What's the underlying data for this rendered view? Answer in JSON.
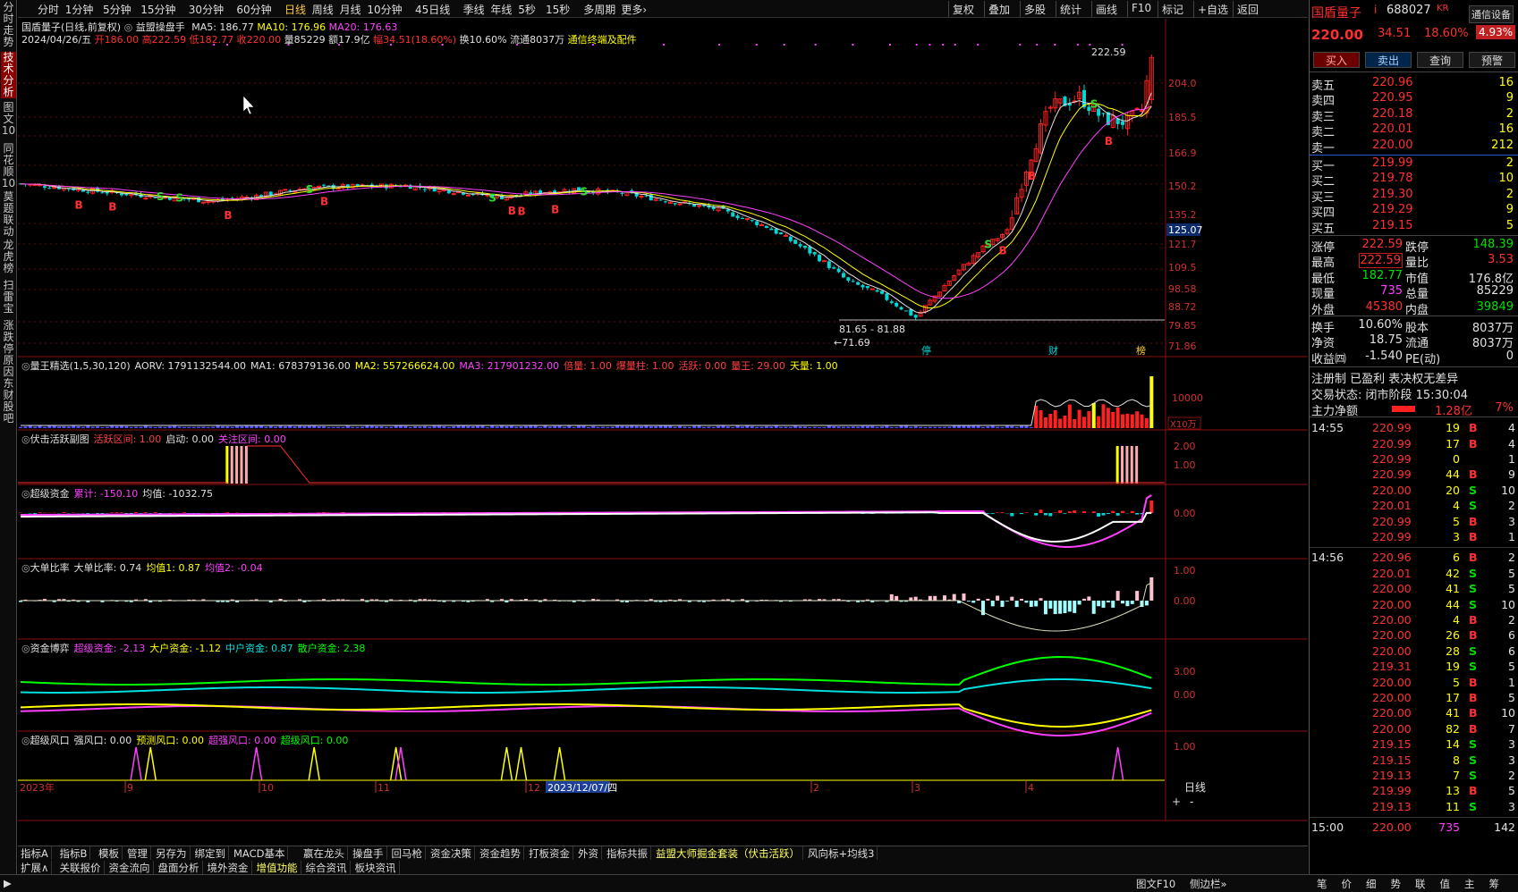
{
  "left_tabs": [
    "分时走势",
    "技术分析",
    "图文10",
    "同花顺10",
    "莫题联动",
    "龙虎榜",
    "扫雷宝",
    "涨跌停原因",
    "东财股吧"
  ],
  "periods": [
    "分时",
    "1分钟",
    "5分钟",
    "15分钟",
    "30分钟",
    "60分钟",
    "日线",
    "周线",
    "月线",
    "10分钟",
    "45日线",
    "季线",
    "年线",
    "5秒",
    "15秒",
    "多周期",
    "更多›"
  ],
  "selected_period": "日线",
  "top_right": [
    "复权",
    "叠加",
    "多股",
    "统计",
    "画线",
    "F10",
    "标记",
    "+自选",
    "返回"
  ],
  "main_title": "国盾量子(日线,前复权)",
  "indicator_name": "益盟操盘手",
  "ma": {
    "ma5": "MA5: 186.77",
    "ma10": "MA10: 176.96",
    "ma20": "MA20: 176.63"
  },
  "ohlc_line": {
    "date": "2024/04/26/五",
    "open": "开186.00",
    "high": "高222.59",
    "low": "低182.77",
    "close": "收220.00",
    "vol": "量85229",
    "amt": "额17.9亿",
    "change": "幅34.51(18.60%)",
    "turnover": "换10.60%",
    "float": "流通8037万",
    "note": "通信终端及配件"
  },
  "price_axis": [
    "204.0",
    "185.5",
    "166.9",
    "150.2",
    "135.2",
    "121.7",
    "109.5",
    "98.58",
    "88.72",
    "79.85",
    "71.86"
  ],
  "current_price_tag": "125.07",
  "annotations": {
    "high": "222.59",
    "low": "71.69",
    "range": "81.65 - 81.88"
  },
  "event_marks": [
    "停",
    "财",
    "榜"
  ],
  "panes": [
    {
      "id": "volume",
      "title": "量王精选(1,5,30,120)",
      "items": [
        {
          "t": "AORV: 1791132544.00",
          "c": "#e0e0e0"
        },
        {
          "t": "MA1: 678379136.00",
          "c": "#e0e0e0"
        },
        {
          "t": "MA2: 557266624.00",
          "c": "#ffff00"
        },
        {
          "t": "MA3: 217901232.00",
          "c": "#ff40ff"
        },
        {
          "t": "倍量: 1.00",
          "c": "#ff4040"
        },
        {
          "t": "爆量柱: 1.00",
          "c": "#ff4040"
        },
        {
          "t": "活跃: 0.00",
          "c": "#ff4040"
        },
        {
          "t": "量王: 29.00",
          "c": "#ff4040"
        },
        {
          "t": "天量: 1.00",
          "c": "#ffff00"
        }
      ],
      "axis": [
        "10000",
        "X10万"
      ]
    },
    {
      "id": "active",
      "title": "伏击活跃副图",
      "items": [
        {
          "t": "活跃区间: 1.00",
          "c": "#ff4040"
        },
        {
          "t": "启动: 0.00",
          "c": "#e0e0e0"
        },
        {
          "t": "关注区间: 0.00",
          "c": "#ff40ff"
        }
      ],
      "axis": [
        "2.00",
        "1.00"
      ]
    },
    {
      "id": "superfund",
      "title": "超级资金",
      "items": [
        {
          "t": "累计: -150.10",
          "c": "#ff40ff"
        },
        {
          "t": "均值: -1032.75",
          "c": "#e0e0e0"
        }
      ],
      "axis": [
        "0.00"
      ]
    },
    {
      "id": "bigratio",
      "title": "大单比率",
      "items": [
        {
          "t": "大单比率: 0.74",
          "c": "#e0e0e0"
        },
        {
          "t": "均值1: 0.87",
          "c": "#ffff00"
        },
        {
          "t": "均值2: -0.04",
          "c": "#ff40ff"
        }
      ],
      "axis": [
        "1.00",
        "0.00"
      ]
    },
    {
      "id": "game",
      "title": "资金博弈",
      "items": [
        {
          "t": "超级资金: -2.13",
          "c": "#ff40ff"
        },
        {
          "t": "大户资金: -1.12",
          "c": "#ffff00"
        },
        {
          "t": "中户资金: 0.87",
          "c": "#00e0e0"
        },
        {
          "t": "散户资金: 2.38",
          "c": "#00ff00"
        }
      ],
      "axis": [
        "3.00",
        "0.00"
      ]
    },
    {
      "id": "wind",
      "title": "超级风口",
      "items": [
        {
          "t": "强风口: 0.00",
          "c": "#e0e0e0"
        },
        {
          "t": "预测风口: 0.00",
          "c": "#ffff00"
        },
        {
          "t": "超强风口: 0.00",
          "c": "#ff40ff"
        },
        {
          "t": "超级风口: 0.00",
          "c": "#00ff00"
        }
      ],
      "axis": [
        "1.00"
      ]
    }
  ],
  "date_axis": [
    "2023年",
    "9",
    "10",
    "11",
    "12",
    "2023/12/07/四",
    "2",
    "3",
    "4"
  ],
  "date_right": "日线",
  "bottom_tabs1": [
    "指标A",
    "指标B",
    "模板",
    "管理",
    "另存为",
    "绑定到",
    "MACD基本",
    "嬴在龙头",
    "操盘手",
    "回马枪",
    "资金决策",
    "资金趋势",
    "打板资金",
    "外资",
    "指标共振",
    "益盟大师掘金套装（伏击活跃）",
    "风向标+均线3"
  ],
  "bottom_tabs2": [
    "扩展∧",
    "关联报价",
    "资金流向",
    "盘面分析",
    "境外资金",
    "增值功能",
    "综合资讯",
    "板块资讯"
  ],
  "stock": {
    "name": "国盾量子",
    "mark": "i",
    "code": "688027",
    "tag": "KR",
    "price": "220.00",
    "change": "34.51",
    "pct": "18.60%",
    "amp": "4.93%",
    "btn_comm": "通信设备"
  },
  "trade_buttons": [
    "买入",
    "卖出",
    "查询",
    "预警"
  ],
  "order_book": {
    "sells": [
      {
        "l": "卖五",
        "p": "220.96",
        "v": "16"
      },
      {
        "l": "卖四",
        "p": "220.95",
        "v": "9"
      },
      {
        "l": "卖三",
        "p": "220.18",
        "v": "2"
      },
      {
        "l": "卖二",
        "p": "220.01",
        "v": "16"
      },
      {
        "l": "卖一",
        "p": "220.00",
        "v": "212"
      }
    ],
    "buys": [
      {
        "l": "买一",
        "p": "219.99",
        "v": "2"
      },
      {
        "l": "买二",
        "p": "219.78",
        "v": "10"
      },
      {
        "l": "买三",
        "p": "219.30",
        "v": "2"
      },
      {
        "l": "买四",
        "p": "219.29",
        "v": "9"
      },
      {
        "l": "买五",
        "p": "219.15",
        "v": "5"
      }
    ]
  },
  "stats": [
    [
      "涨停",
      "222.59",
      "跌停",
      "148.39"
    ],
    [
      "最高",
      "222.59",
      "量比",
      "3.53"
    ],
    [
      "最低",
      "182.77",
      "市值",
      "176.8亿"
    ],
    [
      "现量",
      "735",
      "总量",
      "85229"
    ],
    [
      "外盘",
      "45380",
      "内盘",
      "39849"
    ],
    [
      "换手",
      "10.60%",
      "股本",
      "8037万"
    ],
    [
      "净资",
      "18.75",
      "流通",
      "8037万"
    ],
    [
      "收益㈣",
      "-1.540",
      "PE(动)",
      "0"
    ]
  ],
  "reg": "注册制 已盈利 表决权无差异",
  "trade_status": "交易状态: 闭市阶段 15:30:04",
  "main_net": {
    "label": "主力净额",
    "value": "1.28亿",
    "pct": "7%"
  },
  "ticks": [
    {
      "t": "14:55",
      "p": "220.99",
      "v": "19",
      "s": "B",
      "n": "4"
    },
    {
      "t": "",
      "p": "220.99",
      "v": "17",
      "s": "B",
      "n": "4"
    },
    {
      "t": "",
      "p": "220.99",
      "v": "0",
      "s": "",
      "n": "1"
    },
    {
      "t": "",
      "p": "220.99",
      "v": "44",
      "s": "B",
      "n": "9"
    },
    {
      "t": "",
      "p": "220.00",
      "v": "20",
      "s": "S",
      "n": "10"
    },
    {
      "t": "",
      "p": "220.01",
      "v": "4",
      "s": "S",
      "n": "2"
    },
    {
      "t": "",
      "p": "220.99",
      "v": "5",
      "s": "B",
      "n": "3"
    },
    {
      "t": "",
      "p": "220.99",
      "v": "3",
      "s": "B",
      "n": "1"
    },
    {
      "t": "14:56",
      "p": "220.96",
      "v": "6",
      "s": "B",
      "n": "2"
    },
    {
      "t": "",
      "p": "220.01",
      "v": "42",
      "s": "S",
      "n": "5"
    },
    {
      "t": "",
      "p": "220.00",
      "v": "41",
      "s": "S",
      "n": "5"
    },
    {
      "t": "",
      "p": "220.00",
      "v": "44",
      "s": "S",
      "n": "10"
    },
    {
      "t": "",
      "p": "220.00",
      "v": "4",
      "s": "B",
      "n": "2"
    },
    {
      "t": "",
      "p": "220.00",
      "v": "26",
      "s": "B",
      "n": "6"
    },
    {
      "t": "",
      "p": "220.00",
      "v": "28",
      "s": "S",
      "n": "6"
    },
    {
      "t": "",
      "p": "219.31",
      "v": "19",
      "s": "S",
      "n": "5"
    },
    {
      "t": "",
      "p": "220.00",
      "v": "5",
      "s": "B",
      "n": "1"
    },
    {
      "t": "",
      "p": "220.00",
      "v": "17",
      "s": "B",
      "n": "5"
    },
    {
      "t": "",
      "p": "220.00",
      "v": "41",
      "s": "B",
      "n": "10"
    },
    {
      "t": "",
      "p": "220.00",
      "v": "82",
      "s": "B",
      "n": "7"
    },
    {
      "t": "",
      "p": "219.15",
      "v": "14",
      "s": "S",
      "n": "3"
    },
    {
      "t": "",
      "p": "219.15",
      "v": "8",
      "s": "S",
      "n": "3"
    },
    {
      "t": "",
      "p": "219.13",
      "v": "7",
      "s": "S",
      "n": "2"
    },
    {
      "t": "",
      "p": "219.99",
      "v": "13",
      "s": "B",
      "n": "5"
    },
    {
      "t": "",
      "p": "219.13",
      "v": "11",
      "s": "S",
      "n": "3"
    },
    {
      "t": "15:00",
      "p": "220.00",
      "v": "735",
      "s": "",
      "n": "142"
    }
  ],
  "status_items": [
    "笔",
    "价",
    "细",
    "势",
    "联",
    "值",
    "主",
    "筹"
  ],
  "status_right": [
    "图文F10",
    "侧边栏»"
  ],
  "colors": {
    "up": "#ff2020",
    "down": "#00d8d8",
    "bg": "#000000",
    "sep": "#8a1010"
  }
}
